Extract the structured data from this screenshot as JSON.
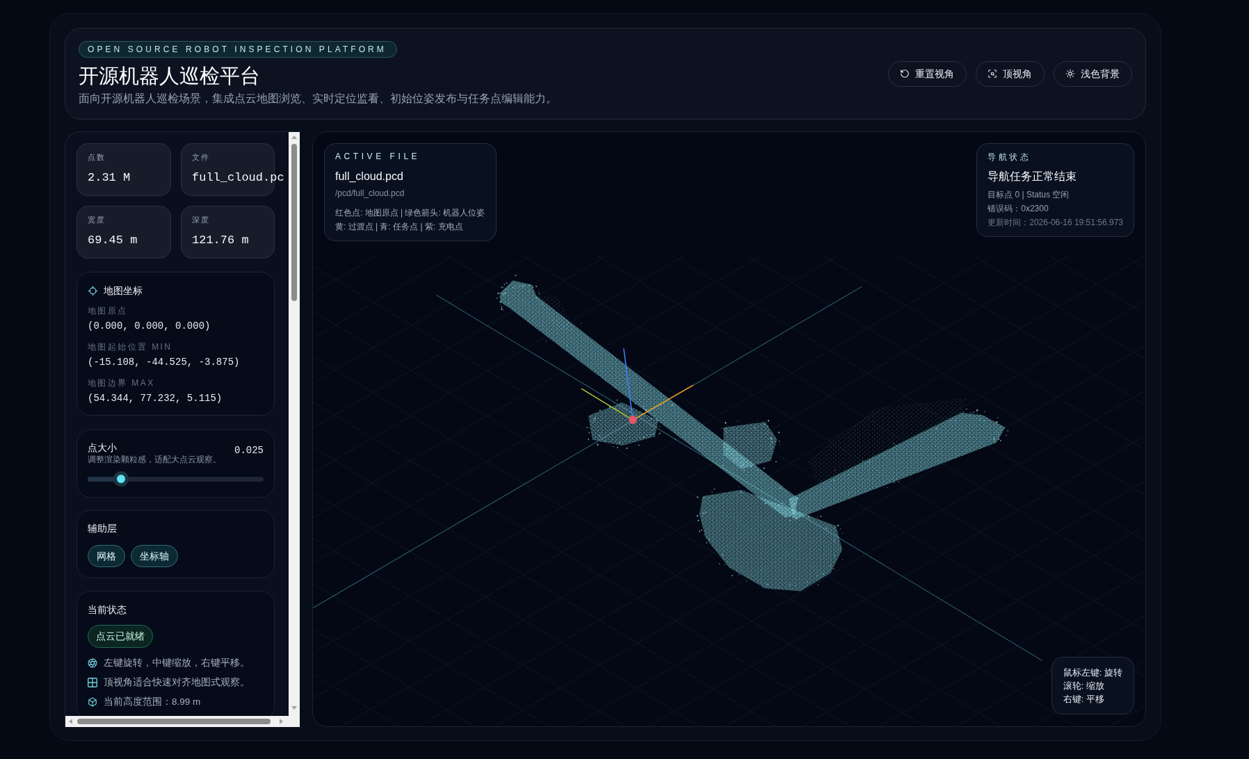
{
  "header": {
    "tagline": "OPEN SOURCE ROBOT INSPECTION PLATFORM",
    "title": "开源机器人巡检平台",
    "subtitle": "面向开源机器人巡检场景，集成点云地图浏览、实时定位监看、初始位姿发布与任务点编辑能力。",
    "buttons": [
      {
        "kind": "reset",
        "label": "重置视角"
      },
      {
        "kind": "top_view",
        "label": "顶视角"
      },
      {
        "kind": "theme",
        "label": "浅色背景"
      }
    ]
  },
  "sidebar": {
    "stats": [
      {
        "label": "点数",
        "value": "2.31 M"
      },
      {
        "label": "文件",
        "value": "full_cloud.pc"
      },
      {
        "label": "宽度",
        "value": "69.45 m"
      },
      {
        "label": "深度",
        "value": "121.76 m"
      }
    ],
    "map_coordinates": {
      "title": "地图坐标",
      "fields": [
        {
          "label": "地图原点",
          "value": "(0.000, 0.000, 0.000)"
        },
        {
          "label": "地图起始位置 MIN",
          "value": "(-15.108, -44.525, -3.875)"
        },
        {
          "label": "地图边界 MAX",
          "value": "(54.344, 77.232, 5.115)"
        }
      ]
    },
    "point_size": {
      "title": "点大小",
      "description": "调整渲染颗粒感，适配大点云观察。",
      "reading": "0.025",
      "level": 0.19
    },
    "layers": {
      "title": "辅助层",
      "toggles": [
        {
          "label": "网格",
          "on": true
        },
        {
          "label": "坐标轴",
          "on": true
        }
      ]
    },
    "status": {
      "title": "当前状态",
      "badge": "点云已就绪",
      "tips": [
        {
          "kind": "orbit",
          "text": "左键旋转，中键缩放，右键平移。"
        },
        {
          "kind": "grid",
          "text": "顶视角适合快速对齐地图式观察。"
        },
        {
          "kind": "height",
          "text": "当前高度范围：8.99 m"
        }
      ]
    }
  },
  "viewport": {
    "active_file": {
      "eyebrow": "ACTIVE FILE",
      "name": "full_cloud.pcd",
      "path": "/pcd/full_cloud.pcd",
      "legend": [
        "红色点: 地图原点 | 绿色箭头: 机器人位姿",
        "黄: 过渡点 | 青: 任务点 | 紫: 充电点"
      ]
    },
    "nav_status": {
      "eyebrow": "导航状态",
      "message": "导航任务正常结束",
      "lines": [
        "目标点 0 | Status 空闲",
        "错误码：0x2300",
        "更新时间：2026-06-16 19:51:56.973"
      ]
    },
    "mouse_hints": [
      "鼠标左键: 旋转",
      "滚轮: 缩放",
      "右键: 平移"
    ]
  }
}
